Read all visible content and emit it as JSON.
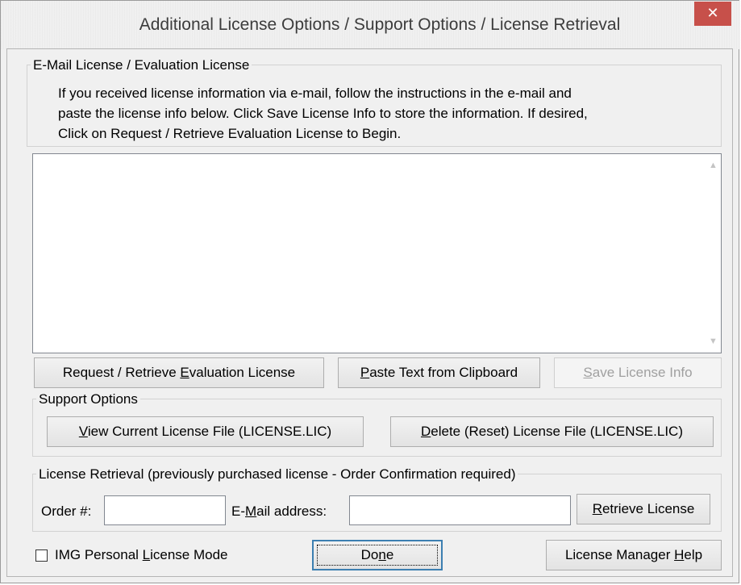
{
  "window": {
    "title": "Additional License Options / Support Options / License Retrieval",
    "close_glyph": "✕"
  },
  "email_section": {
    "legend": "E-Mail License / Evaluation License",
    "instructions": [
      "If you received license information via e-mail, follow the instructions in the e-mail and",
      "paste the license info below. Click Save License Info to store the information.  If desired,",
      "Click on Request / Retrieve Evaluation License to Begin."
    ],
    "license_text": "",
    "scroll_up_glyph": "▲",
    "scroll_down_glyph": "▼"
  },
  "buttons": {
    "request_eval": {
      "pre": "Request / Retrieve ",
      "u": "E",
      "post": "valuation License"
    },
    "paste": {
      "pre": "",
      "u": "P",
      "post": "aste Text from Clipboard"
    },
    "save": {
      "pre": "",
      "u": "S",
      "post": "ave License Info"
    }
  },
  "support_section": {
    "legend": "Support Options",
    "view": {
      "pre": "",
      "u": "V",
      "post": "iew Current License File (LICENSE.LIC)"
    },
    "delete": {
      "pre": "",
      "u": "D",
      "post": "elete (Reset) License File (LICENSE.LIC)"
    }
  },
  "retrieval_section": {
    "legend": "License Retrieval (previously purchased license - Order Confirmation required)",
    "order_label": "Order #:",
    "order_value": "",
    "email_label": {
      "pre": "E-",
      "u": "M",
      "post": "ail address:"
    },
    "email_value": "",
    "retrieve": {
      "pre": "",
      "u": "R",
      "post": "etrieve License"
    }
  },
  "footer": {
    "personal_mode": {
      "pre": "IMG Personal ",
      "u": "L",
      "post": "icense Mode"
    },
    "personal_mode_checked": false,
    "done": {
      "pre": "Do",
      "u": "n",
      "post": "e"
    },
    "help": {
      "pre": "License Manager ",
      "u": "H",
      "post": "elp"
    }
  },
  "colors": {
    "background": "#f0f0f0",
    "close_button": "#c7504a",
    "disabled_text": "#a0a0a0",
    "default_button_border": "#3c7fb1"
  }
}
